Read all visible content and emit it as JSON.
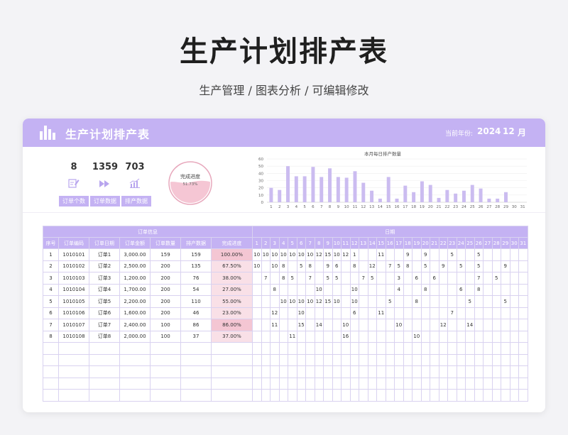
{
  "page": {
    "title": "生产计划排产表",
    "subtitle": "生产管理 / 图表分析 / 可编辑修改"
  },
  "header": {
    "title": "生产计划排产表",
    "year_label": "当前年份:",
    "year": "2024",
    "month": "12",
    "month_unit": "月"
  },
  "stats": [
    {
      "value": "8",
      "label": "订单个数",
      "icon": "edit-icon"
    },
    {
      "value": "1359",
      "label": "订单数据",
      "icon": "fast-forward-icon"
    },
    {
      "value": "703",
      "label": "排产数据",
      "icon": "bar-chart-icon"
    }
  ],
  "progress": {
    "label": "完成进度",
    "value_text": "51.73%",
    "fraction": 0.5173
  },
  "chart_data": {
    "type": "bar",
    "title": "本月每日排产数量",
    "categories": [
      "1",
      "2",
      "3",
      "4",
      "5",
      "6",
      "7",
      "8",
      "9",
      "10",
      "11",
      "12",
      "13",
      "14",
      "15",
      "16",
      "17",
      "18",
      "19",
      "20",
      "21",
      "22",
      "23",
      "24",
      "25",
      "26",
      "27",
      "28",
      "29",
      "30",
      "31"
    ],
    "values": [
      20,
      17,
      50,
      36,
      36,
      49,
      35,
      47,
      35,
      34,
      43,
      27,
      16,
      5,
      35,
      5,
      23,
      14,
      29,
      24,
      6,
      17,
      12,
      16,
      24,
      19,
      5,
      5,
      14,
      0,
      0
    ],
    "ylim": [
      0,
      60
    ],
    "yticks": [
      0,
      10,
      20,
      30,
      40,
      50,
      60
    ],
    "bar_color": "#cbbcf0"
  },
  "table": {
    "group_order": "订单信息",
    "group_date": "日期",
    "headers": [
      "序号",
      "订单编码",
      "订单日期",
      "订单金额",
      "订单数量",
      "排产数据",
      "完成进度"
    ],
    "days": [
      "1",
      "2",
      "3",
      "4",
      "5",
      "6",
      "7",
      "8",
      "9",
      "10",
      "11",
      "12",
      "13",
      "14",
      "15",
      "16",
      "17",
      "18",
      "19",
      "20",
      "21",
      "22",
      "23",
      "24",
      "25",
      "26",
      "27",
      "28",
      "29",
      "30",
      "31"
    ],
    "rows": [
      {
        "cells": [
          "1",
          "1010101",
          "订单1",
          "3,000.00",
          "159",
          "159",
          "100.00%"
        ],
        "strong": true,
        "days": [
          "10",
          "10",
          "10",
          "10",
          "10",
          "10",
          "10",
          "12",
          "15",
          "10",
          "12",
          "1",
          "",
          "",
          "11",
          "",
          "",
          "9",
          "",
          "9",
          "",
          "",
          "5",
          "",
          "",
          "5",
          "",
          "",
          "",
          "",
          ""
        ]
      },
      {
        "cells": [
          "2",
          "1010102",
          "订单2",
          "2,500.00",
          "200",
          "135",
          "67.50%"
        ],
        "strong": false,
        "days": [
          "10",
          "",
          "10",
          "8",
          "",
          "5",
          "8",
          "",
          "9",
          "6",
          "",
          "8",
          "",
          "12",
          "",
          "7",
          "5",
          "8",
          "",
          "5",
          "",
          "9",
          "",
          "5",
          "",
          "5",
          "",
          "",
          "9",
          "",
          ""
        ]
      },
      {
        "cells": [
          "3",
          "1010103",
          "订单3",
          "1,200.00",
          "200",
          "76",
          "38.00%"
        ],
        "strong": false,
        "days": [
          "",
          "7",
          "",
          "8",
          "5",
          "",
          "7",
          "",
          "5",
          "5",
          "",
          "",
          "7",
          "5",
          "",
          "",
          "3",
          "",
          "6",
          "",
          "6",
          "",
          "",
          "",
          "",
          "7",
          "",
          "5",
          "",
          "",
          ""
        ]
      },
      {
        "cells": [
          "4",
          "1010104",
          "订单4",
          "1,700.00",
          "200",
          "54",
          "27.00%"
        ],
        "strong": false,
        "days": [
          "",
          "",
          "8",
          "",
          "",
          "",
          "",
          "10",
          "",
          "",
          "",
          "10",
          "",
          "",
          "",
          "",
          "4",
          "",
          "",
          "8",
          "",
          "",
          "",
          "6",
          "",
          "8",
          "",
          "",
          "",
          "",
          ""
        ]
      },
      {
        "cells": [
          "5",
          "1010105",
          "订单5",
          "2,200.00",
          "200",
          "110",
          "55.00%"
        ],
        "strong": false,
        "days": [
          "",
          "",
          "",
          "10",
          "10",
          "10",
          "10",
          "12",
          "15",
          "10",
          "",
          "10",
          "",
          "",
          "",
          "5",
          "",
          "",
          "8",
          "",
          "",
          "",
          "",
          "",
          "5",
          "",
          "",
          "",
          "5",
          "",
          ""
        ]
      },
      {
        "cells": [
          "6",
          "1010106",
          "订单6",
          "1,600.00",
          "200",
          "46",
          "23.00%"
        ],
        "strong": false,
        "days": [
          "",
          "",
          "12",
          "",
          "",
          "10",
          "",
          "",
          "",
          "",
          "",
          "6",
          "",
          "",
          "11",
          "",
          "",
          "",
          "",
          "",
          "",
          "",
          "7",
          "",
          "",
          "",
          "",
          "",
          "",
          "",
          ""
        ]
      },
      {
        "cells": [
          "7",
          "1010107",
          "订单7",
          "2,400.00",
          "100",
          "86",
          "86.00%"
        ],
        "strong": true,
        "days": [
          "",
          "",
          "11",
          "",
          "",
          "15",
          "",
          "14",
          "",
          "",
          "10",
          "",
          "",
          "",
          "",
          "",
          "10",
          "",
          "",
          "",
          "",
          "12",
          "",
          "",
          "14",
          "",
          "",
          "",
          "",
          "",
          ""
        ]
      },
      {
        "cells": [
          "8",
          "1010108",
          "订单8",
          "2,000.00",
          "100",
          "37",
          "37.00%"
        ],
        "strong": false,
        "days": [
          "",
          "",
          "",
          "",
          "11",
          "",
          "",
          "",
          "",
          "",
          "16",
          "",
          "",
          "",
          "",
          "",
          "",
          "",
          "10",
          "",
          "",
          "",
          "",
          "",
          "",
          "",
          "",
          "",
          "",
          "",
          ""
        ]
      }
    ],
    "empty_rows": 5
  }
}
